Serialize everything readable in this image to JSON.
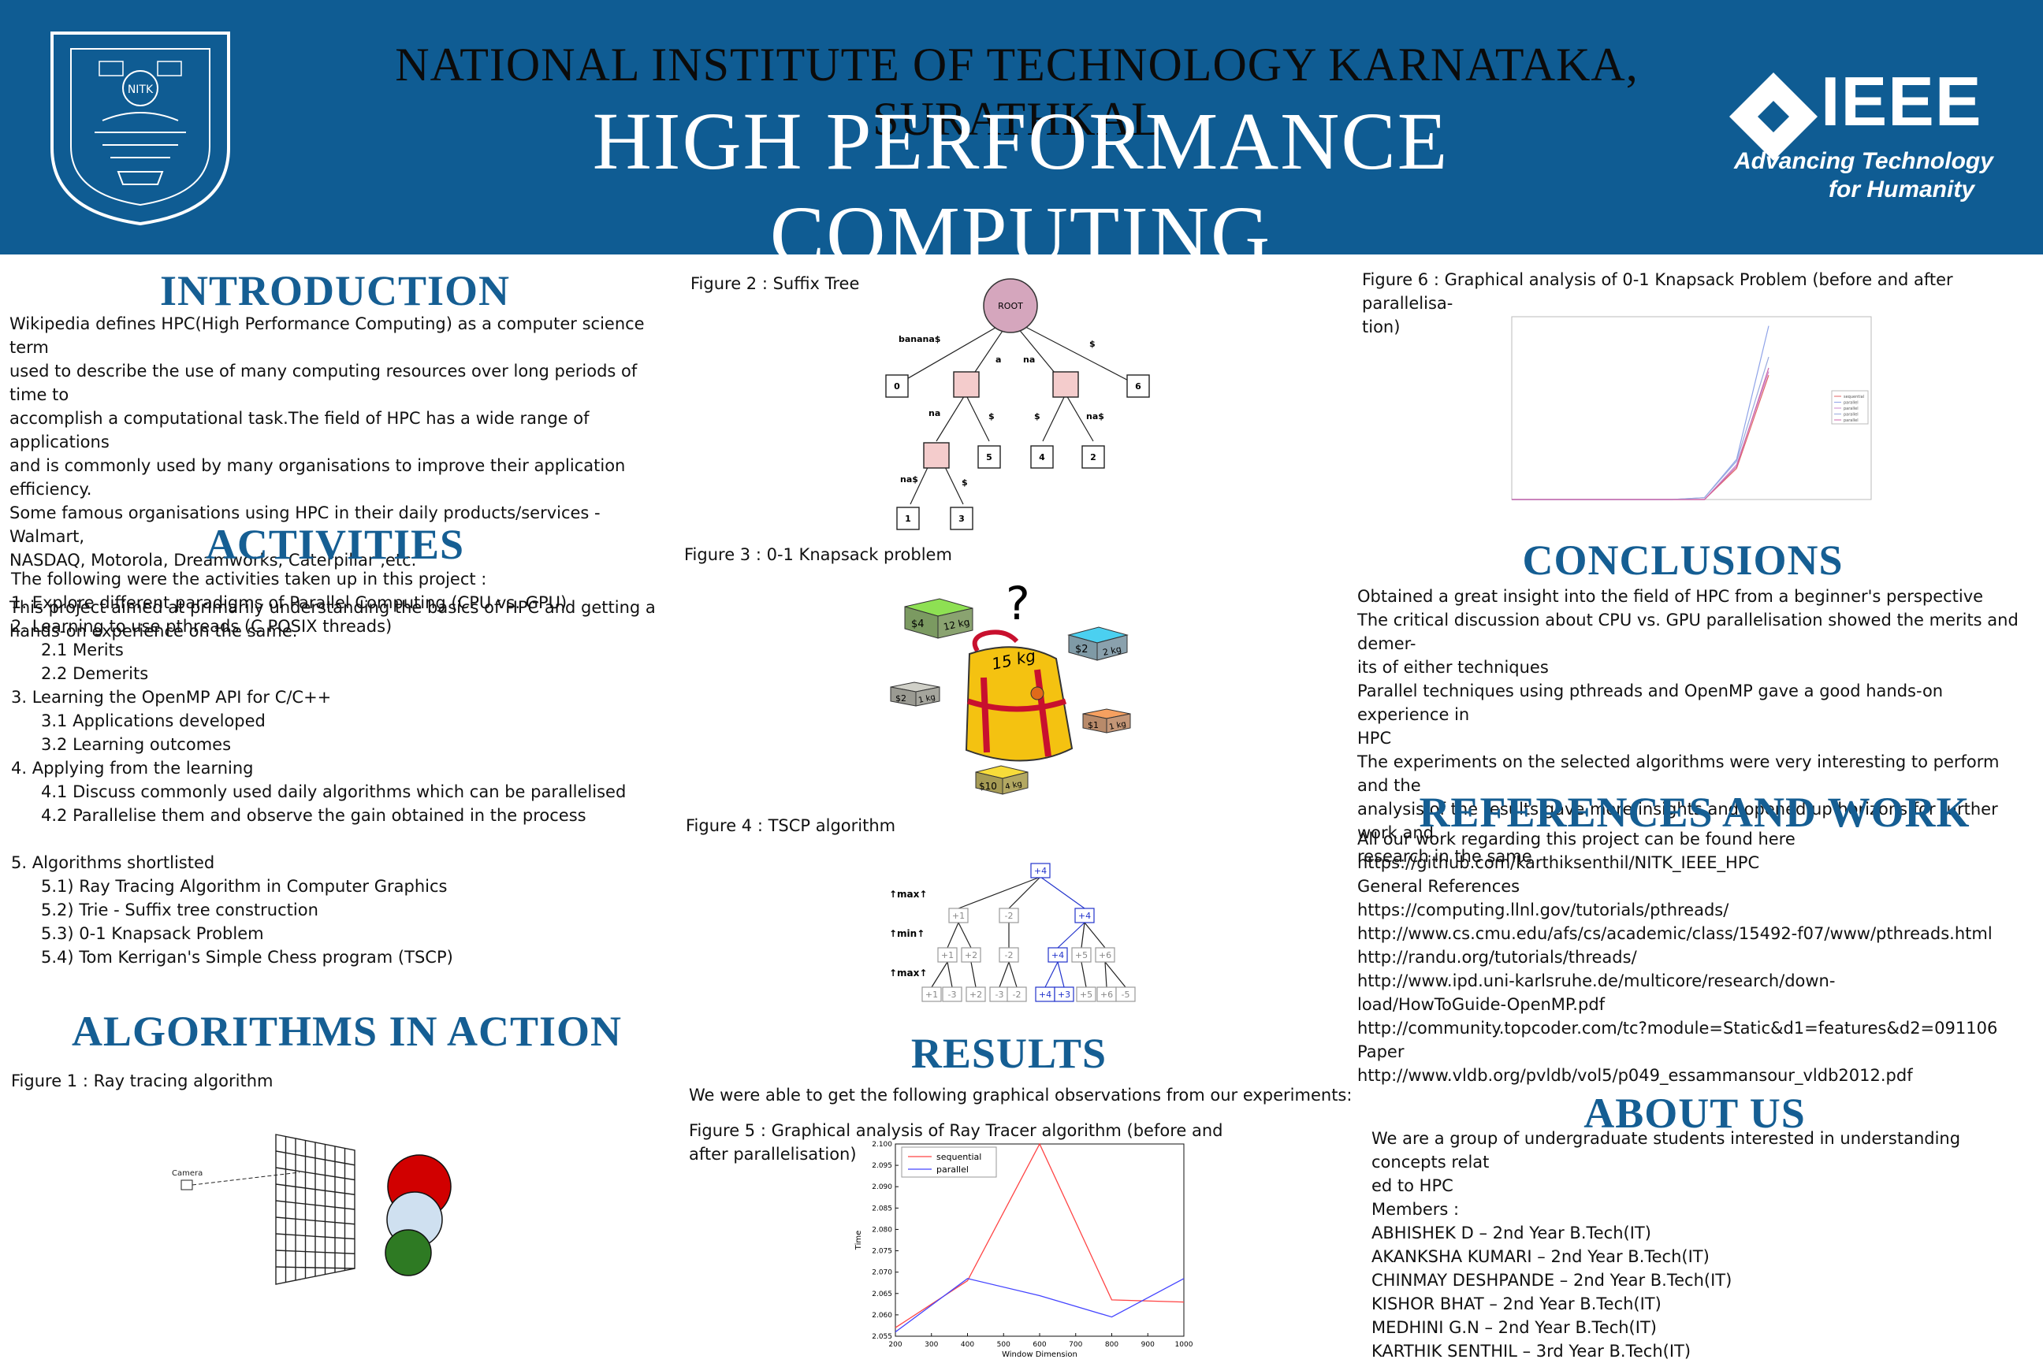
{
  "header": {
    "institute": "NATIONAL INSTITUTE OF TECHNOLOGY KARNATAKA, SURATHKAL",
    "title": "HIGH PERFORMANCE COMPUTING",
    "seal": {
      "text_top": "NATIONAL INSTITUTE OF TECHNOLOGY KARNATAKA, SURATHKAL",
      "inner": "NITK"
    },
    "ieee": {
      "word": "IEEE",
      "tagline_1": "Advancing Technology",
      "tagline_2": "for Humanity"
    }
  },
  "introduction": {
    "heading": "INTRODUCTION",
    "para1_lines": [
      "Wikipedia defines HPC(High Performance Computing) as a computer science term",
      "used to describe the use of many computing resources over long periods of time to",
      "accomplish a computational task.The field of HPC has a wide range of applications",
      "and is commonly used by many organisations to improve their application efficiency.",
      "Some famous organisations using HPC in their daily products/services - Walmart,",
      "NASDAQ, Motorola, Dreamworks, Caterpillar ,etc."
    ],
    "para2_lines": [
      "This project aimed at primarily understanding the basics of HPC and getting a",
      "hands-on experience on the same."
    ]
  },
  "activities": {
    "heading": "ACTIVITIES",
    "lines": [
      {
        "text": "The following were the activities taken up in this project :",
        "indent": false
      },
      {
        "text": "1. Explore different paradigms of Parallel Computing (CPU vs. GPU)",
        "indent": false
      },
      {
        "text": "2. Learning to use pthreads (C POSIX threads)",
        "indent": false
      },
      {
        "text": "2.1 Merits",
        "indent": true
      },
      {
        "text": "2.2 Demerits",
        "indent": true
      },
      {
        "text": "3. Learning the OpenMP API for C/C++",
        "indent": false
      },
      {
        "text": "3.1 Applications developed",
        "indent": true
      },
      {
        "text": "3.2 Learning outcomes",
        "indent": true
      },
      {
        "text": "4. Applying from the learning",
        "indent": false
      },
      {
        "text": "4.1 Discuss commonly used daily algorithms which can be parallelised",
        "indent": true
      },
      {
        "text": "4.2 Parallelise them and observe the gain obtained in the process",
        "indent": true
      },
      {
        "text": "",
        "indent": false
      },
      {
        "text": "5. Algorithms shortlisted",
        "indent": false
      },
      {
        "text": "5.1) Ray Tracing Algorithm in Computer Graphics",
        "indent": true
      },
      {
        "text": "5.2) Trie - Suffix tree construction",
        "indent": true
      },
      {
        "text": "5.3) 0-1 Knapsack Problem",
        "indent": true
      },
      {
        "text": "5.4) Tom Kerrigan's Simple Chess program (TSCP)",
        "indent": true
      }
    ]
  },
  "algorithms": {
    "heading": "ALGORITHMS IN ACTION",
    "fig1_caption": "Figure 1 : Ray tracing algorithm",
    "fig1_camera_label": "Camera"
  },
  "fig2": {
    "caption": "Figure 2 : Suffix Tree",
    "root": "ROOT",
    "edges": [
      "banana$",
      "a",
      "na",
      "$",
      "na",
      "$",
      "$",
      "na$",
      "na$",
      "$"
    ],
    "leaves": [
      "0",
      "6",
      "5",
      "4",
      "2",
      "1",
      "3"
    ]
  },
  "fig3": {
    "caption": "Figure 3 : 0-1 Knapsack problem",
    "question": "?",
    "bag": "15 kg",
    "items": [
      {
        "value": "$4",
        "weight": "12 kg",
        "color": "#7ccd3a"
      },
      {
        "value": "$2",
        "weight": "2 kg",
        "color": "#4bc4e8"
      },
      {
        "value": "$2",
        "weight": "1 kg",
        "color": "#b8b8b0"
      },
      {
        "value": "$1",
        "weight": "1 kg",
        "color": "#f0924a"
      },
      {
        "value": "$10",
        "weight": "4 kg",
        "color": "#f2d23a"
      }
    ]
  },
  "fig4": {
    "caption": "Figure 4 : TSCP algorithm",
    "labels": [
      "max",
      "min",
      "max"
    ],
    "root": "+4",
    "level1": [
      "+1",
      "-2",
      "+4"
    ],
    "level2": [
      "+1",
      "+2",
      "-2",
      "+4",
      "+5",
      "+6"
    ],
    "level3": [
      "+1",
      "-3",
      "+2",
      "-3",
      "-2",
      "+4",
      "+3",
      "+5",
      "+6",
      "-5"
    ]
  },
  "results": {
    "heading": "RESULTS",
    "intro": "We were able to get the following graphical observations from our experiments:",
    "fig5_caption_l1": "Figure 5 : Graphical analysis of Ray Tracer algorithm (before and",
    "fig5_caption_l2": "after parallelisation)"
  },
  "chart_data": [
    {
      "type": "line",
      "title": "",
      "xlabel": "Window Dimension",
      "ylabel": "Time",
      "x": [
        200,
        400,
        600,
        800,
        1000
      ],
      "xticks": [
        "200",
        "300",
        "400",
        "500",
        "600",
        "700",
        "800",
        "900",
        "1000"
      ],
      "yticks": [
        "2.055",
        "2.060",
        "2.065",
        "2.070",
        "2.075",
        "2.080",
        "2.085",
        "2.090",
        "2.095",
        "2.100"
      ],
      "xlim": [
        200,
        1000
      ],
      "ylim": [
        2.055,
        2.1
      ],
      "legend": "top-left",
      "series": [
        {
          "name": "sequential",
          "color": "#ff4444",
          "values": [
            2.057,
            2.068,
            2.1,
            2.0635,
            2.063
          ]
        },
        {
          "name": "parallel",
          "color": "#4444ff",
          "values": [
            2.056,
            2.0685,
            2.0645,
            2.0595,
            2.0685
          ]
        }
      ]
    },
    {
      "type": "line",
      "title": "",
      "xlabel": "",
      "ylabel": "",
      "x": [
        0,
        1,
        2,
        3,
        4,
        5,
        6,
        7,
        8
      ],
      "xlim": [
        0,
        8
      ],
      "ylim": [
        0,
        100
      ],
      "legend": "right",
      "series": [
        {
          "name": "sequential",
          "color": "#e06666",
          "values": [
            0,
            0,
            0,
            0,
            0,
            0,
            0,
            17,
            68
          ]
        },
        {
          "name": "parallel",
          "color": "#8fa3e8",
          "values": [
            0,
            0,
            0,
            0,
            0,
            0,
            1,
            22,
            95
          ]
        },
        {
          "name": "parallel",
          "color": "#cc88cc",
          "values": [
            0,
            0,
            0,
            0,
            0,
            0,
            0,
            19,
            70
          ]
        },
        {
          "name": "parallel",
          "color": "#99aadd",
          "values": [
            0,
            0,
            0,
            0,
            0,
            0,
            1,
            21,
            78
          ]
        },
        {
          "name": "parallel",
          "color": "#cc66aa",
          "values": [
            0,
            0,
            0,
            0,
            0,
            0,
            0,
            18,
            72
          ]
        }
      ]
    }
  ],
  "fig6": {
    "caption_l1": "Figure 6 : Graphical analysis of 0-1 Knapsack Problem (before and after parallelisa-",
    "caption_l2": "tion)"
  },
  "conclusions": {
    "heading": "CONCLUSIONS",
    "lines": [
      "Obtained a great insight into the field of HPC from a beginner's perspective",
      "The critical discussion about CPU vs. GPU parallelisation showed the merits and demer-",
      "its of either techniques",
      "Parallel techniques using pthreads and OpenMP gave a good hands-on experience in",
      "HPC",
      "The experiments on the selected algorithms were very interesting to perform and the",
      "analysis of the results gave more insights and opened up horizons for further work and",
      "research in the same"
    ]
  },
  "references": {
    "heading": "REFERENCES AND WORK",
    "lines": [
      {
        "text": "All our work regarding this project can be found here",
        "link": false
      },
      {
        "text": "https://github.com/karthiksenthil/NITK_IEEE_HPC",
        "link": true
      },
      {
        "text": "General References",
        "link": false
      },
      {
        "text": "https://computing.llnl.gov/tutorials/pthreads/",
        "link": true
      },
      {
        "text": "http://www.cs.cmu.edu/afs/cs/academic/class/15492-f07/www/pthreads.html",
        "link": true
      },
      {
        "text": "http://randu.org/tutorials/threads/",
        "link": true
      },
      {
        "text": "http://www.ipd.uni-karlsruhe.de/multicore/research/down-",
        "link": true
      },
      {
        "text": "load/HowToGuide-OpenMP.pdf",
        "link": true
      },
      {
        "text": "http://community.topcoder.com/tc?module=Static&d1=features&d2=091106",
        "link": true
      },
      {
        "text": "Paper",
        "link": false
      },
      {
        "text": "http://www.vldb.org/pvldb/vol5/p049_essammansour_vldb2012.pdf",
        "link": true
      }
    ]
  },
  "about": {
    "heading": "ABOUT US",
    "lines": [
      "We are a group of undergraduate students interested in understanding concepts relat",
      "ed to HPC",
      "Members :",
      "ABHISHEK D – 2nd Year B.Tech(IT)",
      "AKANKSHA KUMARI – 2nd Year B.Tech(IT)",
      "CHINMAY DESHPANDE – 2nd Year B.Tech(IT)",
      "KISHOR BHAT – 2nd Year B.Tech(IT)",
      "MEDHINI G.N – 2nd Year B.Tech(IT)",
      "KARTHIK SENTHIL – 3rd Year B.Tech(IT)"
    ]
  }
}
